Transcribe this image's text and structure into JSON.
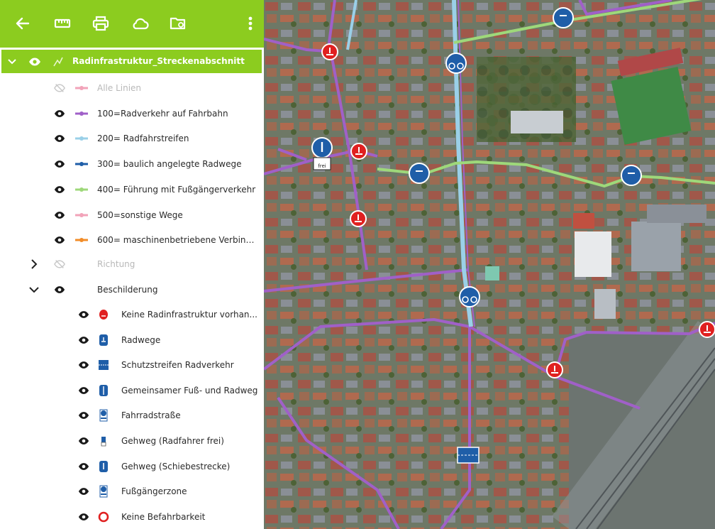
{
  "layer": {
    "title": "Radinfrastruktur_Streckenabschnitt",
    "items": [
      {
        "label": "Alle Linien",
        "color": "#f2a3b9",
        "visible": false
      },
      {
        "label": "100=Radverkehr auf Fahrbahn",
        "color": "#a060c8",
        "visible": true
      },
      {
        "label": "200= Radfahrstreifen",
        "color": "#9ad0e8",
        "visible": true
      },
      {
        "label": "300= baulich angelegte Radwege",
        "color": "#1f5ea8",
        "visible": true
      },
      {
        "label": "400= Führung mit Fußgängerverkehr",
        "color": "#9ed87a",
        "visible": true
      },
      {
        "label": "500=sonstige Wege",
        "color": "#f2a3b9",
        "visible": true
      },
      {
        "label": "600= maschinenbetriebene Verbind...",
        "color": "#f28c28",
        "visible": true
      }
    ]
  },
  "groups": {
    "richtung": {
      "label": "Richtung",
      "visible": false
    },
    "beschilderung": {
      "label": "Beschilderung",
      "visible": true
    }
  },
  "signs": [
    {
      "label": "Keine Radinfrastruktur vorhan...",
      "icon": "no-bike-sign-icon"
    },
    {
      "label": "Radwege",
      "icon": "bike-path-sign-icon"
    },
    {
      "label": "Schutzstreifen Radverkehr",
      "icon": "bike-lane-sign-icon"
    },
    {
      "label": "Gemeinsamer Fuß- und Radweg",
      "icon": "shared-path-sign-icon"
    },
    {
      "label": "Fahrradstraße",
      "icon": "bike-street-sign-icon"
    },
    {
      "label": "Gehweg (Radfahrer frei)",
      "icon": "sidewalk-bikes-allowed-sign-icon"
    },
    {
      "label": "Gehweg (Schiebestrecke)",
      "icon": "sidewalk-push-bike-sign-icon"
    },
    {
      "label": "Fußgängerzone",
      "icon": "pedestrian-zone-sign-icon"
    },
    {
      "label": "Keine Befahrbarkeit",
      "icon": "no-entry-sign-icon"
    }
  ],
  "map": {
    "sign_label": "frei"
  },
  "colors": {
    "accent": "#8ccc1f",
    "route_purple": "#a060c8",
    "route_green": "#9ed87a",
    "route_lightblue": "#9ad0e8",
    "sign_blue": "#1f5ea8",
    "sign_red": "#e02020"
  }
}
